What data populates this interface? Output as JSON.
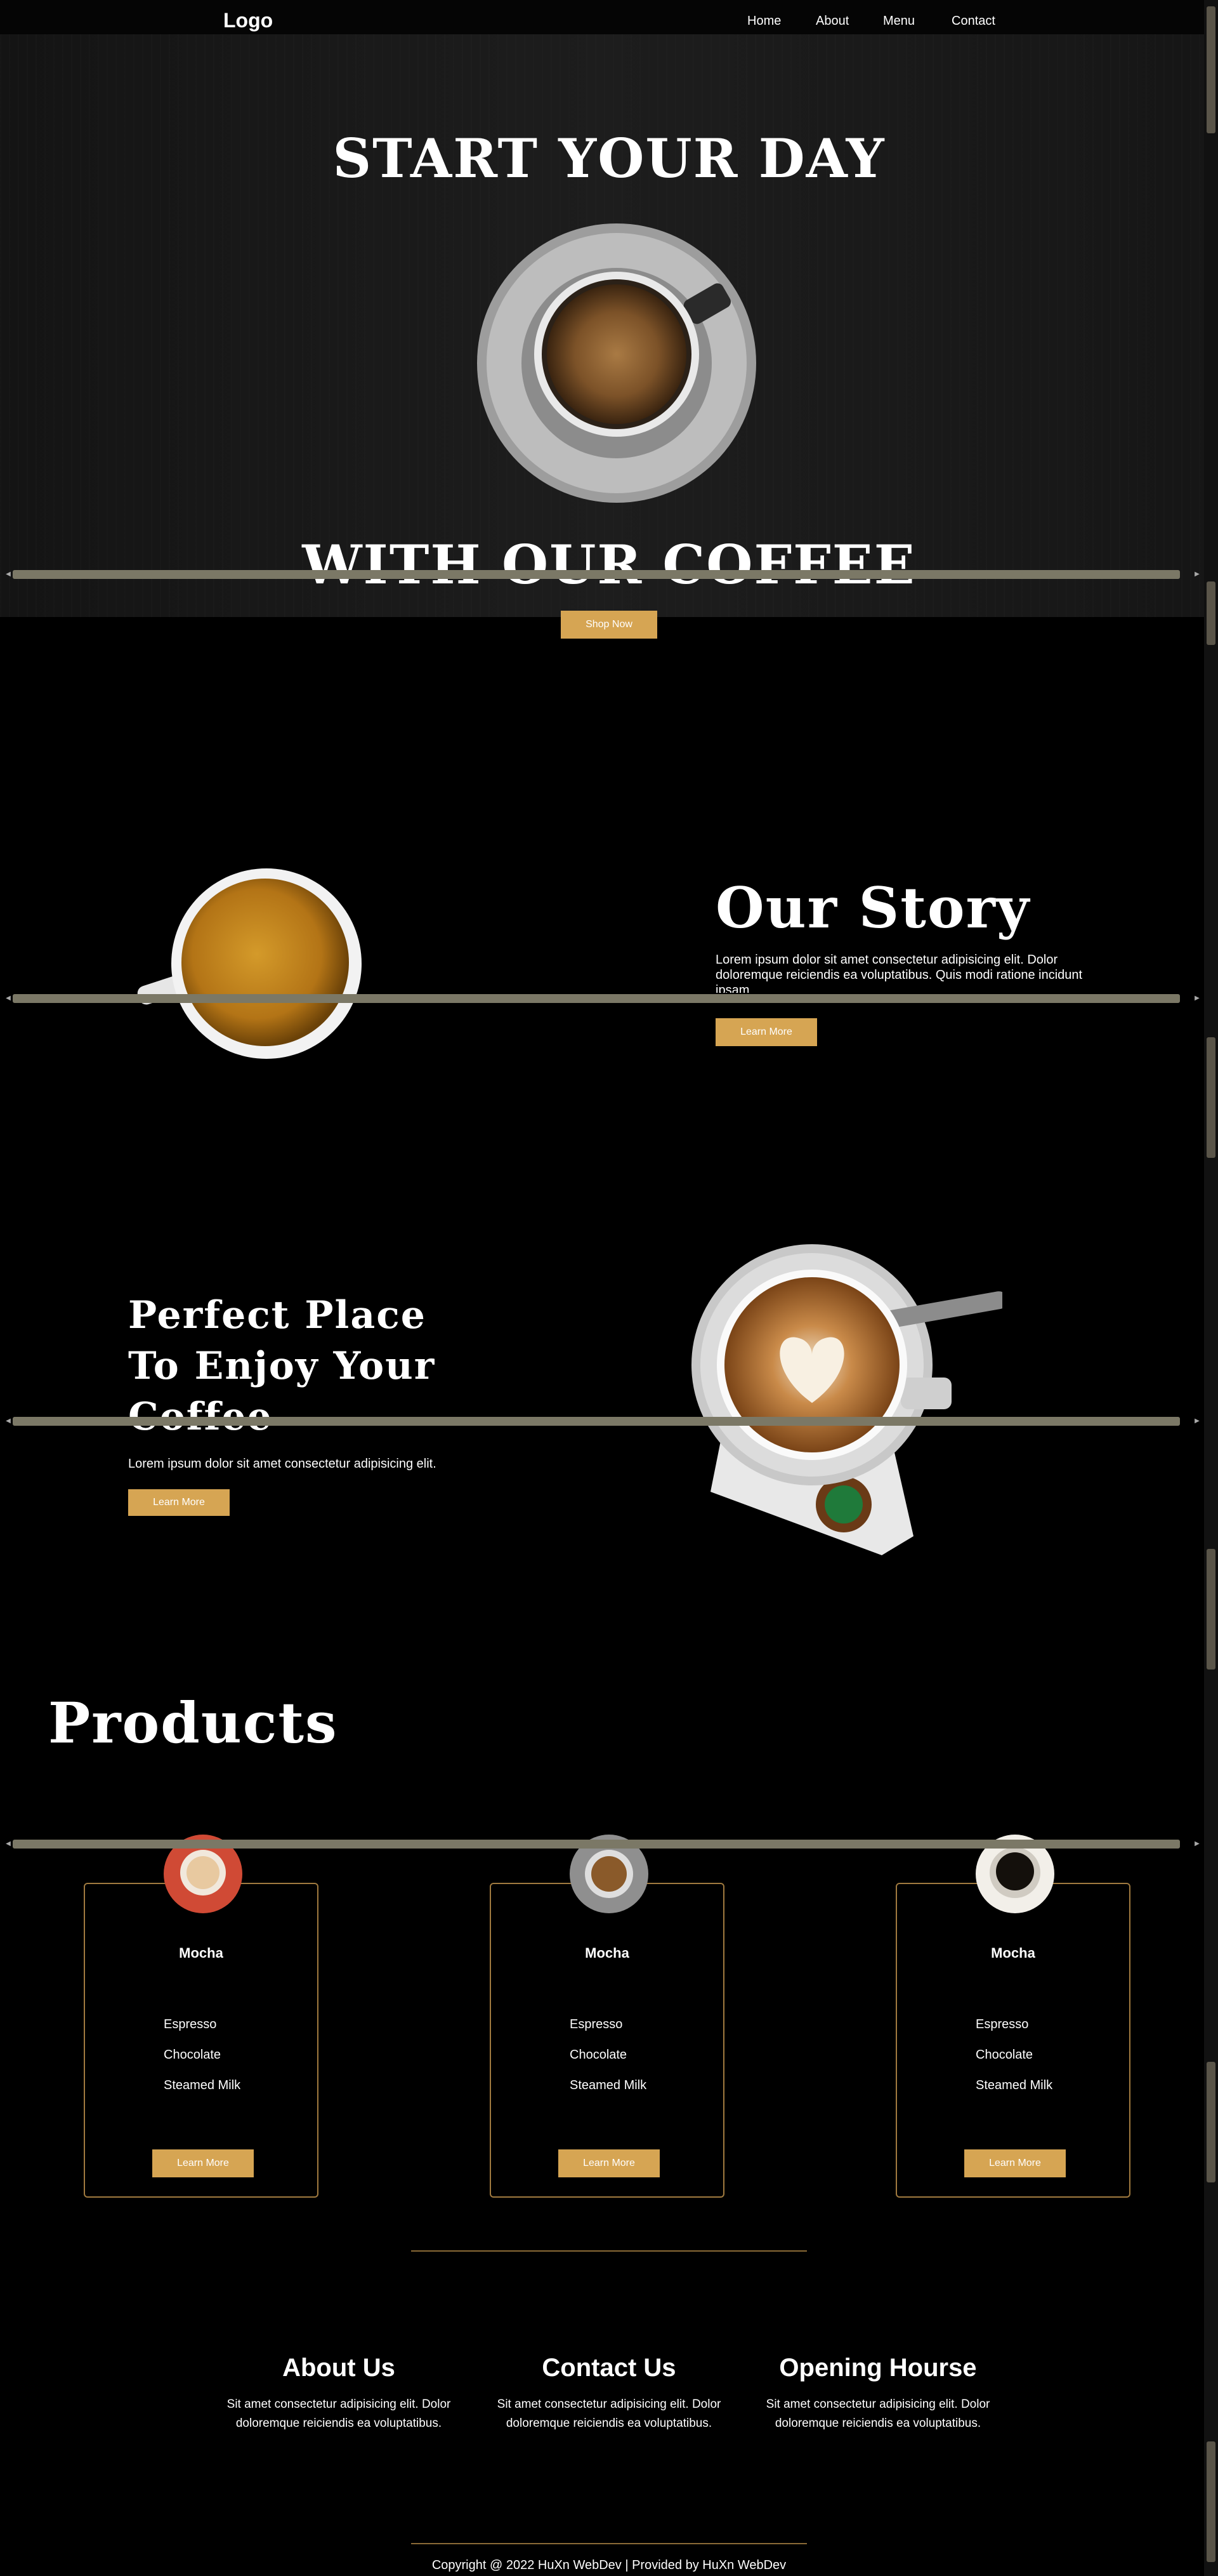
{
  "nav": {
    "logo": "Logo",
    "links": [
      "Home",
      "About",
      "Menu",
      "Contact"
    ]
  },
  "hero": {
    "title_line1": "START YOUR DAY",
    "title_line2": "WITH OUR COFFEE",
    "cta": "Shop Now"
  },
  "story": {
    "title": "Our Story",
    "text": "Lorem ipsum dolor sit amet consectetur adipisicing elit. Dolor doloremque reiciendis ea voluptatibus. Quis modi ratione incidunt ipsam",
    "cta": "Learn More"
  },
  "place": {
    "title_line1": "Perfect Place",
    "title_line2": "To Enjoy Your",
    "title_line3": "Coffee",
    "text": "Lorem ipsum dolor sit amet consectetur adipisicing elit.",
    "cta": "Learn More"
  },
  "products": {
    "title": "Products",
    "items": [
      {
        "name": "Mocha",
        "ingredients": [
          "Espresso",
          "Chocolate",
          "Steamed Milk"
        ],
        "cta": "Learn More"
      },
      {
        "name": "Mocha",
        "ingredients": [
          "Espresso",
          "Chocolate",
          "Steamed Milk"
        ],
        "cta": "Learn More"
      },
      {
        "name": "Mocha",
        "ingredients": [
          "Espresso",
          "Chocolate",
          "Steamed Milk"
        ],
        "cta": "Learn More"
      }
    ]
  },
  "footer": {
    "columns": [
      {
        "title": "About Us",
        "text": "Sit amet consectetur adipisicing elit. Dolor doloremque reiciendis ea voluptatibus."
      },
      {
        "title": "Contact Us",
        "text": "Sit amet consectetur adipisicing elit. Dolor doloremque reiciendis ea voluptatibus."
      },
      {
        "title": "Opening Hourse",
        "text": "Sit amet consectetur adipisicing elit. Dolor doloremque reiciendis ea voluptatibus."
      }
    ],
    "copyright": "Copyright @ 2022 HuXn WebDev | Provided by HuXn WebDev"
  },
  "colors": {
    "accent": "#d6a553",
    "card_border": "#a07a3f",
    "background": "#000000"
  }
}
